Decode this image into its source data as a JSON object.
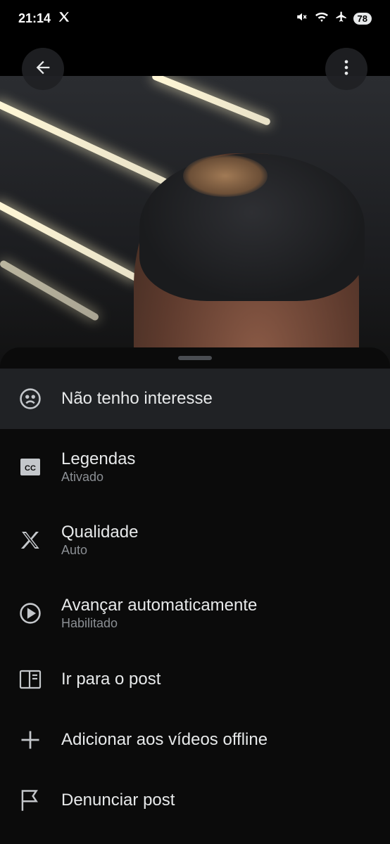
{
  "status_bar": {
    "time": "21:14",
    "battery": "78",
    "icons": [
      "x-logo-icon",
      "mute-icon",
      "wifi-icon",
      "airplane-icon",
      "battery-icon"
    ]
  },
  "video": {
    "buttons": [
      "back-arrow-icon",
      "more-vertical-icon"
    ]
  },
  "menu": {
    "items": [
      {
        "label": "Não tenho interesse",
        "icon": "sad-face-icon"
      },
      {
        "label": "Legendas",
        "sub": "Ativado",
        "icon": "closed-captions-icon"
      },
      {
        "label": "Qualidade",
        "sub": "Auto",
        "icon": "x-logo-icon"
      },
      {
        "label": "Avançar automaticamente",
        "sub": "Habilitado",
        "icon": "play-circle-icon"
      },
      {
        "label": "Ir para o post",
        "icon": "post-panel-icon"
      },
      {
        "label": "Adicionar aos vídeos offline",
        "icon": "plus-icon"
      },
      {
        "label": "Denunciar post",
        "icon": "flag-icon"
      }
    ]
  },
  "colors": {
    "background": "#000000",
    "sheet": "#0b0b0b",
    "highlight_row": "#202225",
    "text": "#e7e9ea",
    "subtext": "#8b8f94"
  }
}
